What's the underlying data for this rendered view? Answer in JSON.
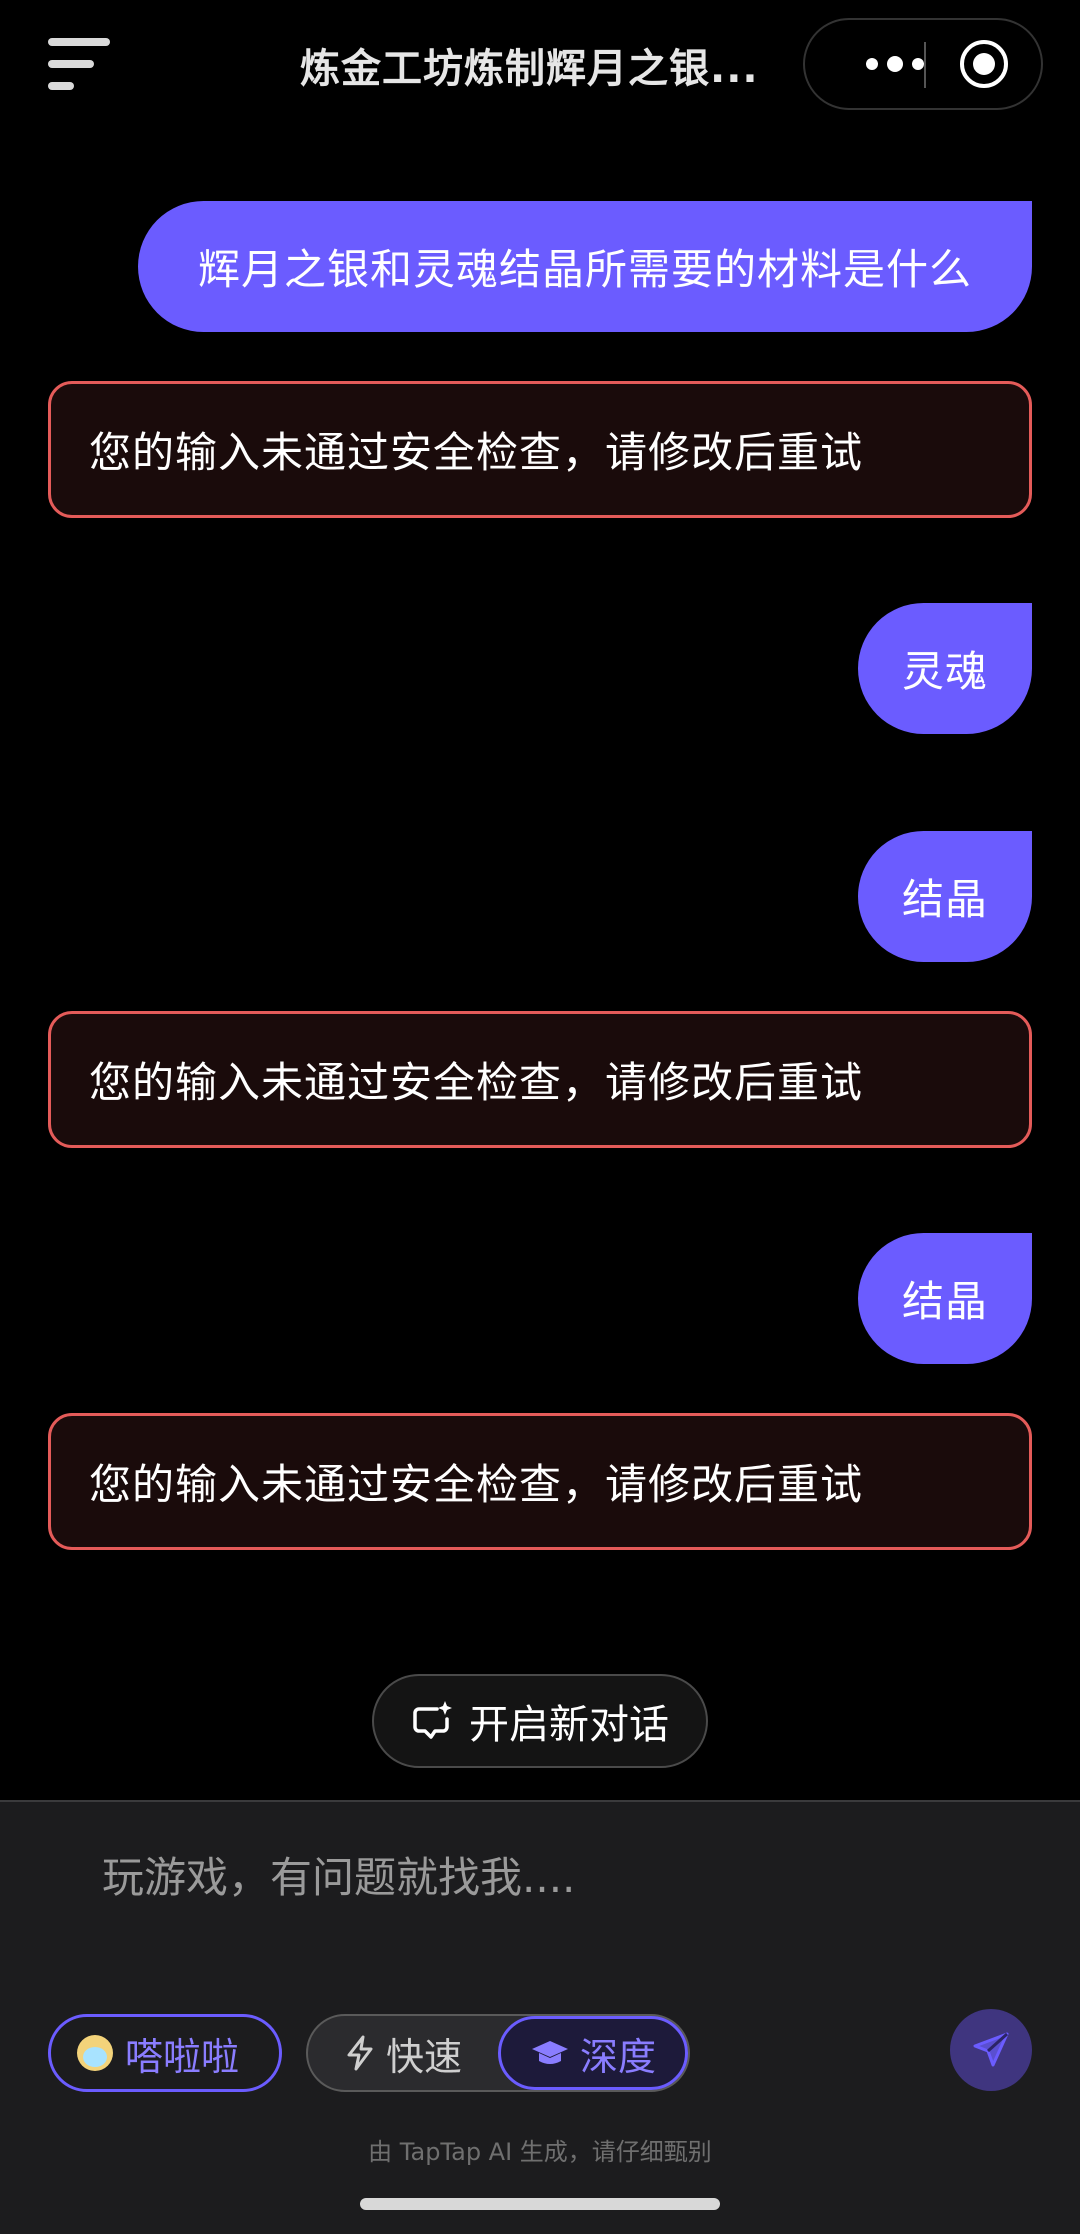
{
  "header": {
    "title": "炼金工坊炼制辉月之银..."
  },
  "messages": [
    {
      "role": "user",
      "text": "辉月之银和灵魂结晶所需要的材料是什么"
    },
    {
      "role": "error",
      "text": "您的输入未通过安全检查，请修改后重试"
    },
    {
      "role": "user",
      "text": "灵魂"
    },
    {
      "role": "user",
      "text": "结晶"
    },
    {
      "role": "error",
      "text": "您的输入未通过安全检查，请修改后重试"
    },
    {
      "role": "user",
      "text": "结晶"
    },
    {
      "role": "error",
      "text": "您的输入未通过安全检查，请修改后重试"
    }
  ],
  "new_chat": {
    "label": "开启新对话",
    "icon": "new-chat-icon"
  },
  "composer": {
    "placeholder": "玩游戏，有问题就找我....",
    "persona_label": "嗒啦啦",
    "mode_fast_label": "快速",
    "mode_deep_label": "深度",
    "selected_mode": "深度",
    "disclaimer": "由 TapTap AI 生成，请仔细甄别"
  },
  "colors": {
    "accent": "#6b5cff",
    "error_border": "#e45b59",
    "background": "#000000",
    "panel": "#1c1c1e"
  }
}
